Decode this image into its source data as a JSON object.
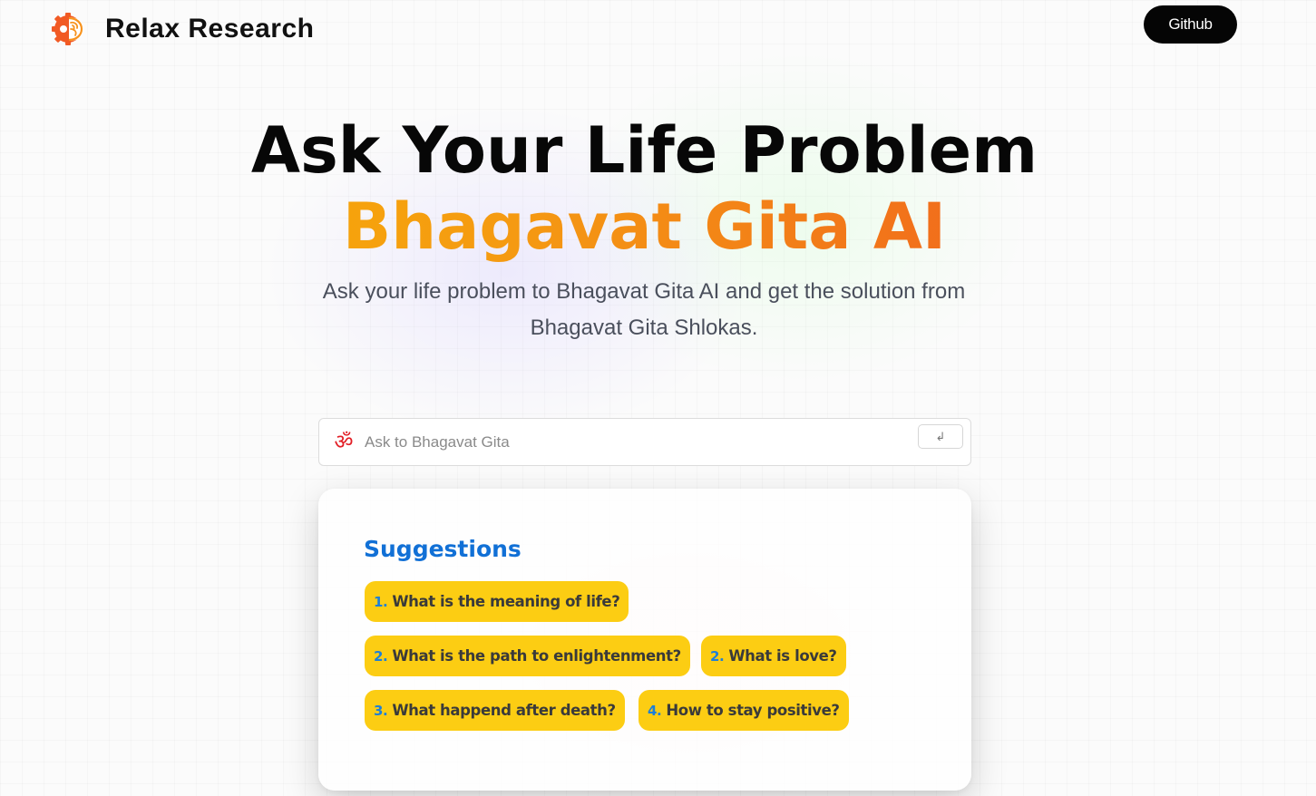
{
  "header": {
    "brand": "Relax Research",
    "github_label": "Github"
  },
  "hero": {
    "title_line1": "Ask Your Life Problem",
    "title_line2": "Bhagavat Gita AI",
    "subtitle_line1": "Ask your life problem to Bhagavat Gita AI and get the solution from",
    "subtitle_line2": "Bhagavat Gita Shlokas."
  },
  "search": {
    "icon": "om-icon",
    "placeholder": "Ask to Bhagavat Gita",
    "enter_symbol": "↲"
  },
  "suggestions": {
    "title": "Suggestions",
    "items": [
      {
        "num": "1.",
        "text": "What is the meaning of life?"
      },
      {
        "num": "2.",
        "text": "What is the path to enlightenment?"
      },
      {
        "num": "2.",
        "text": "What is love?"
      },
      {
        "num": "3.",
        "text": "What happend after death?"
      },
      {
        "num": "4.",
        "text": "How to stay positive?"
      }
    ]
  },
  "colors": {
    "accent_blue": "#1170d6",
    "chip_yellow": "#fccd13",
    "title_gradient_start": "#f7b500",
    "title_gradient_end": "#ee5a1f",
    "github_bg": "#050505"
  }
}
